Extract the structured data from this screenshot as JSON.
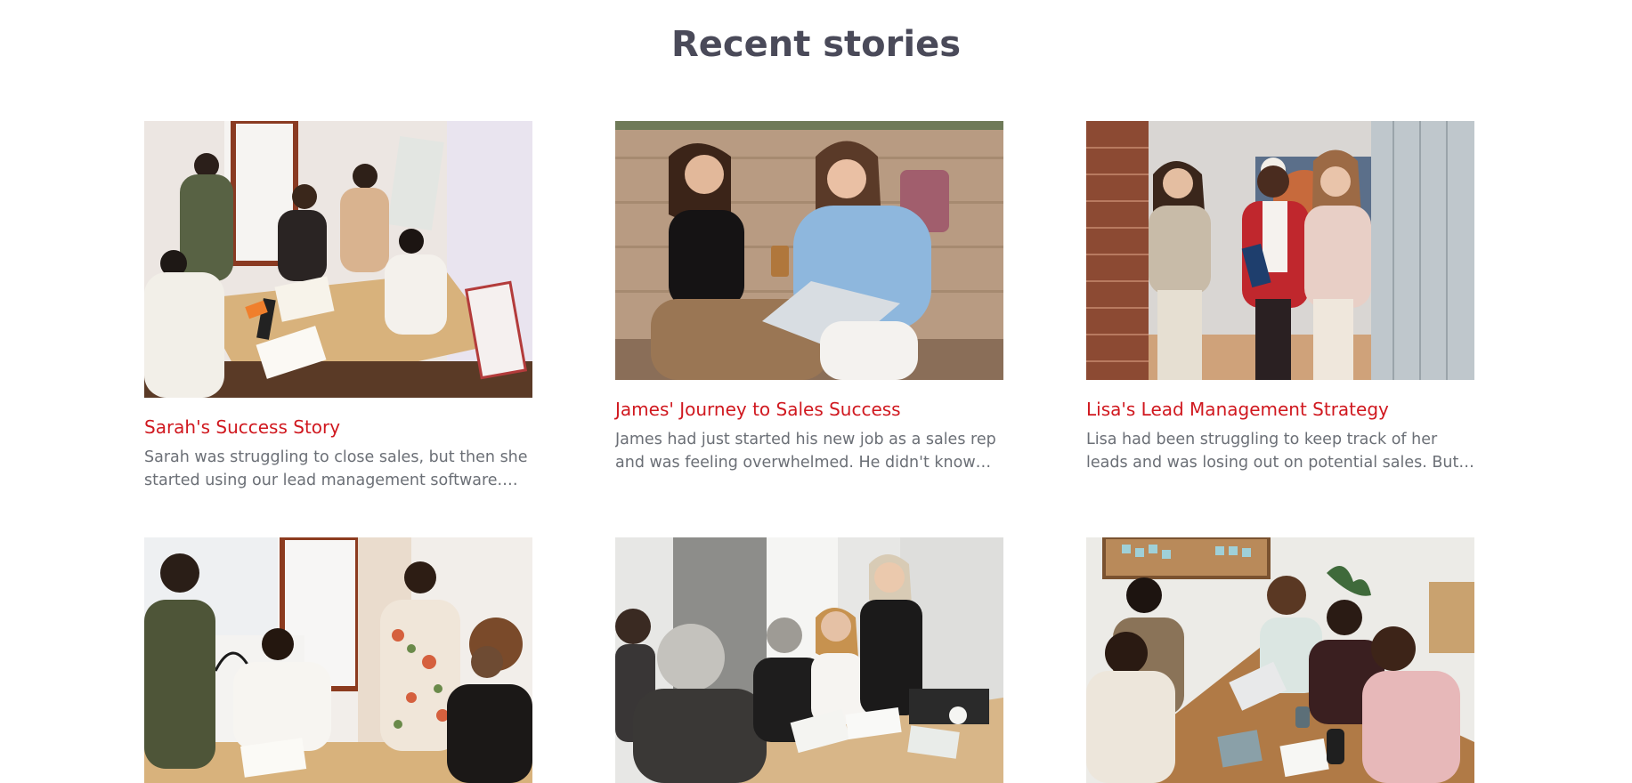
{
  "section": {
    "title": "Recent stories"
  },
  "stories": [
    {
      "title": "Sarah's Success Story",
      "excerpt": "Sarah was struggling to close sales, but then she started using our lead management software. With it she was finally able to organize her pipeline."
    },
    {
      "title": "James' Journey to Sales Success",
      "excerpt": "James had just started his new job as a sales rep and was feeling overwhelmed. He didn't know how to keep up with all of his prospects."
    },
    {
      "title": "Lisa's Lead Management Strategy",
      "excerpt": "Lisa had been struggling to keep track of her leads and was losing out on potential sales. But then she discovered a better way."
    },
    {
      "title": "",
      "excerpt": ""
    },
    {
      "title": "",
      "excerpt": ""
    },
    {
      "title": "",
      "excerpt": ""
    }
  ]
}
